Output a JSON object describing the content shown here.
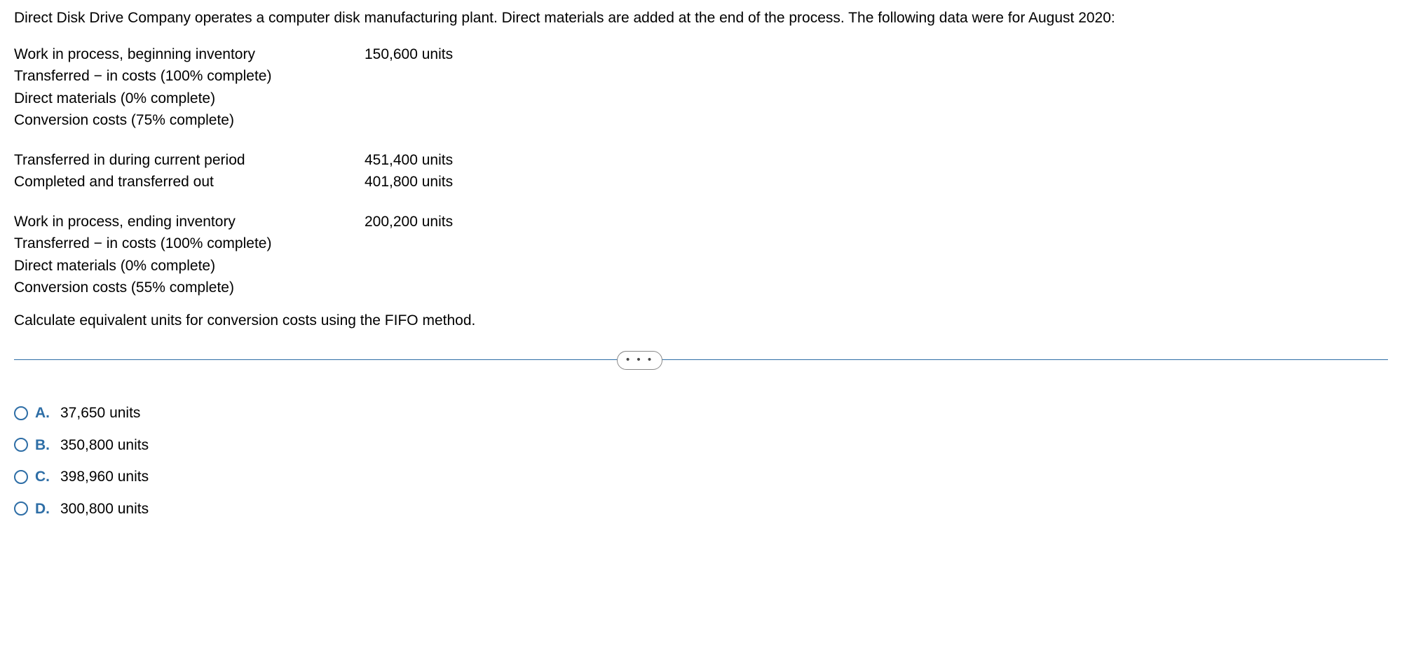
{
  "intro": "Direct Disk Drive Company operates a computer disk manufacturing plant. Direct materials are added at the end of the process. The following data were for August 2020:",
  "blocks": [
    {
      "rows": [
        {
          "label": "Work in process, beginning inventory",
          "value": "150,600 units"
        },
        {
          "label": "Transferred − in costs (100% complete)",
          "value": ""
        },
        {
          "label": "Direct materials (0% complete)",
          "value": ""
        },
        {
          "label": "Conversion costs (75% complete)",
          "value": ""
        }
      ]
    },
    {
      "rows": [
        {
          "label": "Transferred in during current period",
          "value": "451,400 units"
        },
        {
          "label": "Completed and transferred out",
          "value": "401,800 units"
        }
      ]
    },
    {
      "rows": [
        {
          "label": "Work in process, ending inventory",
          "value": "200,200 units"
        },
        {
          "label": "Transferred − in costs (100% complete)",
          "value": ""
        },
        {
          "label": "Direct materials (0% complete)",
          "value": ""
        },
        {
          "label": "Conversion costs (55% complete)",
          "value": ""
        }
      ]
    }
  ],
  "question": "Calculate equivalent units for conversion costs using the FIFO method.",
  "ellipsis": "•  •  •",
  "options": [
    {
      "letter": "A.",
      "text": "37,650 units"
    },
    {
      "letter": "B.",
      "text": "350,800 units"
    },
    {
      "letter": "C.",
      "text": "398,960 units"
    },
    {
      "letter": "D.",
      "text": "300,800 units"
    }
  ]
}
